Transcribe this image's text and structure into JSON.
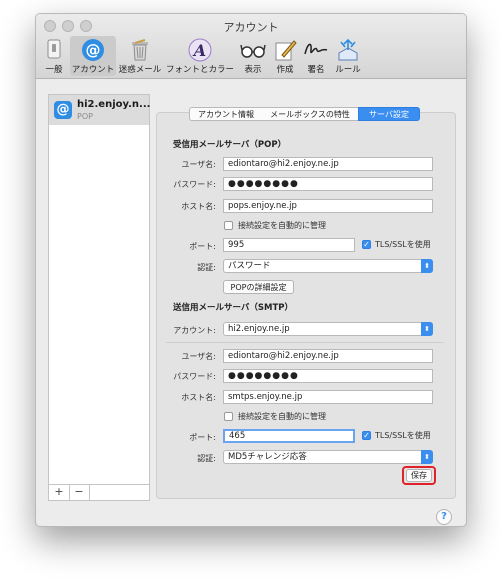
{
  "window": {
    "title": "アカウント"
  },
  "toolbar": {
    "items": [
      {
        "label": "一般",
        "icon": "switch-icon"
      },
      {
        "label": "アカウント",
        "icon": "at-sign-icon"
      },
      {
        "label": "迷惑メール",
        "icon": "trash-icon"
      },
      {
        "label": "フォントとカラー",
        "icon": "font-color-icon"
      },
      {
        "label": "表示",
        "icon": "glasses-icon"
      },
      {
        "label": "作成",
        "icon": "compose-icon"
      },
      {
        "label": "署名",
        "icon": "signature-icon"
      },
      {
        "label": "ルール",
        "icon": "rules-icon"
      }
    ]
  },
  "sidebar": {
    "account": {
      "name": "hi2.enjoy.n...",
      "type": "POP"
    },
    "add_label": "+",
    "remove_label": "−"
  },
  "tabs": {
    "account_info": "アカウント情報",
    "mailbox": "メールボックスの特性",
    "server": "サーバ設定"
  },
  "incoming": {
    "section_title": "受信用メールサーバ（POP）",
    "username_label": "ユーザ名:",
    "username": "ediontaro@hi2.enjoy.ne.jp",
    "password_label": "パスワード:",
    "password": "●●●●●●●●",
    "host_label": "ホスト名:",
    "host": "pops.enjoy.ne.jp",
    "auto_manage_label": "接続設定を自動的に管理",
    "port_label": "ポート:",
    "port": "995",
    "tls_label": "TLS/SSLを使用",
    "auth_label": "認証:",
    "auth": "パスワード",
    "details_button": "POPの詳細設定"
  },
  "outgoing": {
    "section_title": "送信用メールサーバ（SMTP）",
    "account_label": "アカウント:",
    "account": "hi2.enjoy.ne.jp",
    "username_label": "ユーザ名:",
    "username": "ediontaro@hi2.enjoy.ne.jp",
    "password_label": "パスワード:",
    "password": "●●●●●●●●",
    "host_label": "ホスト名:",
    "host": "smtps.enjoy.ne.jp",
    "auto_manage_label": "接続設定を自動的に管理",
    "port_label": "ポート:",
    "port": "465",
    "tls_label": "TLS/SSLを使用",
    "auth_label": "認証:",
    "auth": "MD5チャレンジ応答"
  },
  "save_button": "保存",
  "help_button": "?"
}
